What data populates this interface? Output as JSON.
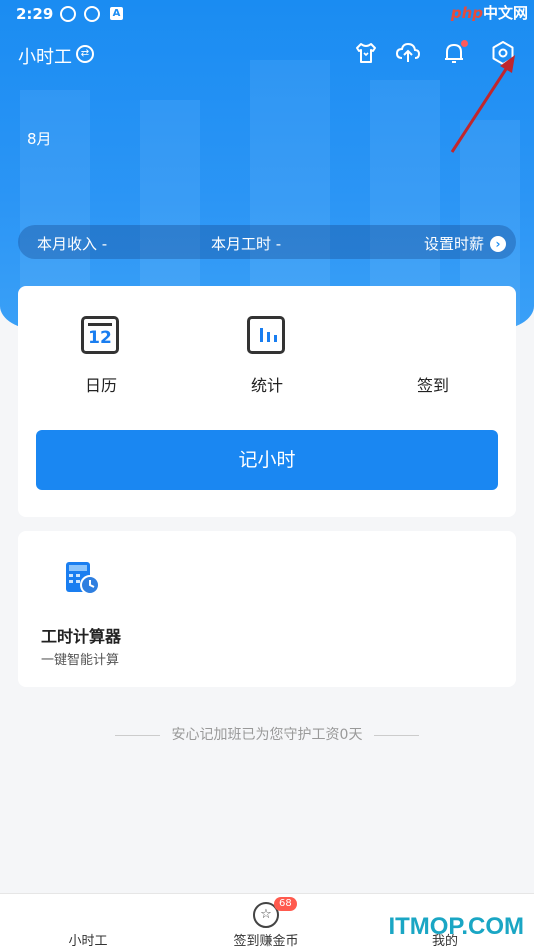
{
  "status_bar": {
    "time": "2:29",
    "indicator": "A"
  },
  "watermark": {
    "top_php": "php",
    "top_cn": "中文网",
    "bottom": "ITMOP.COM"
  },
  "header": {
    "title": "小时工",
    "icons": [
      "shirt-icon",
      "cloud-upload-icon",
      "bell-icon",
      "settings-icon"
    ]
  },
  "month_label": "8月",
  "summary": {
    "income_label": "本月收入 -",
    "hours_label": "本月工时 -",
    "set_wage_label": "设置时薪",
    "set_wage_chevron": "›"
  },
  "quick_actions": [
    {
      "label": "日历",
      "icon": "calendar-icon",
      "calendar_day": "12"
    },
    {
      "label": "统计",
      "icon": "stats-icon"
    },
    {
      "label": "签到",
      "icon": "check-in-icon"
    }
  ],
  "record_button": "记小时",
  "tool_card": {
    "title": "工时计算器",
    "subtitle": "一键智能计算",
    "icon": "calculator-icon"
  },
  "footer_note": "安心记加班已为您守护工资0天",
  "tab_bar": [
    {
      "label": "小时工"
    },
    {
      "label": "签到赚金币",
      "badge": "68",
      "icon": "coin-star-icon"
    },
    {
      "label": "我的"
    }
  ],
  "colors": {
    "primary": "#1a87f2",
    "badge": "#ff5a4e",
    "page_bg": "#f5f6f8"
  }
}
